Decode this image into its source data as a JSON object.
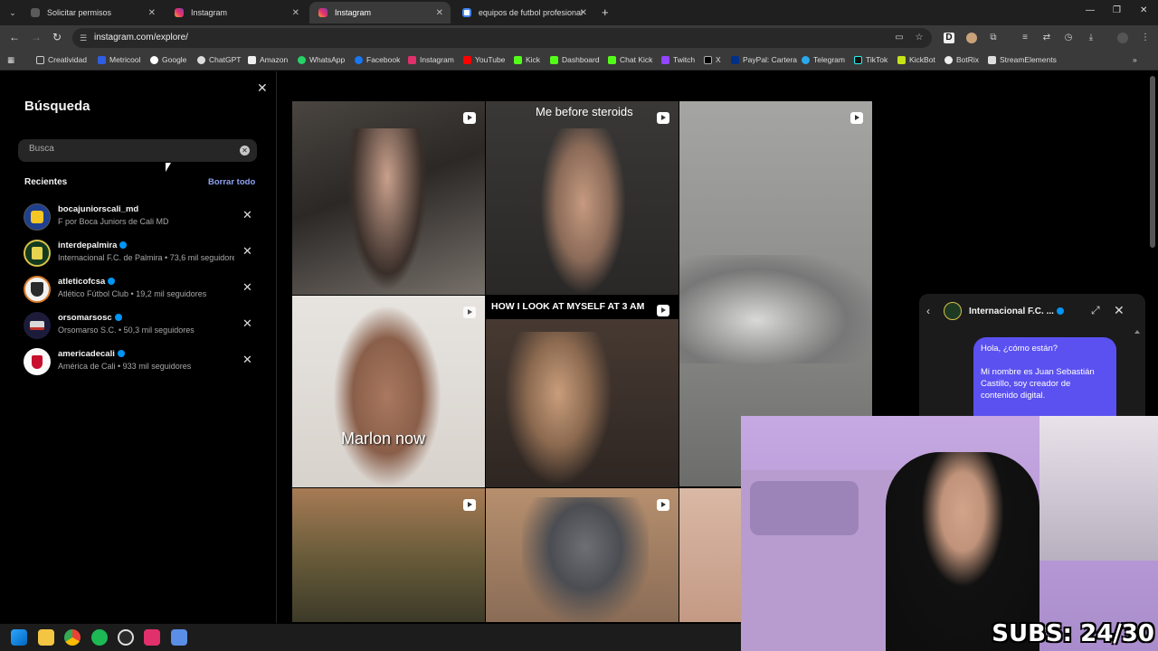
{
  "tabs": [
    {
      "label": "Solicitar permisos",
      "color": "#5a5a5a"
    },
    {
      "label": "Instagram",
      "color": "#e1306c"
    },
    {
      "label": "Instagram",
      "color": "#e1306c",
      "active": true
    },
    {
      "label": "equipos de futbol profesional d",
      "color": "#4285f4"
    }
  ],
  "url": "instagram.com/explore/",
  "bookmarks": [
    "Creatividad",
    "Metricool",
    "Google",
    "ChatGPT",
    "Amazon",
    "WhatsApp",
    "Facebook",
    "Instagram",
    "YouTube",
    "Kick",
    "Dashboard",
    "Chat Kick",
    "Twitch",
    "X",
    "PayPal: Cartera",
    "Telegram",
    "TikTok",
    "KickBot",
    "BotRix",
    "StreamElements"
  ],
  "search": {
    "title": "Búsqueda",
    "placeholder": "Busca",
    "recent_label": "Recientes",
    "clear_all": "Borrar todo",
    "recents": [
      {
        "username": "bocajuniorscali_md",
        "subtitle": "F por Boca Juniors de Cali MD",
        "verified": false
      },
      {
        "username": "interdepalmira",
        "subtitle": "Internacional F.C. de Palmira • 73,6 mil seguidores",
        "verified": true
      },
      {
        "username": "atleticofcsa",
        "subtitle": "Atlético Fútbol Club • 19,2 mil seguidores",
        "verified": true
      },
      {
        "username": "orsomarsosc",
        "subtitle": "Orsomarso S.C. • 50,3 mil seguidores",
        "verified": true
      },
      {
        "username": "americadecali",
        "subtitle": "América de Cali • 933 mil seguidores",
        "verified": true
      }
    ]
  },
  "grid": {
    "captions": {
      "tile2": "Me before steroids",
      "tile4": "Marlon now",
      "tile5": "HOW I LOOK AT MYSELF AT 3 AM"
    }
  },
  "chat": {
    "name": "Internacional F.C. ...",
    "message": "Hola, ¿cómo están?\n\nMi nombre es Juan Sebastián Castillo, soy creador de contenido digital."
  },
  "webcam": {
    "subs": "SUBS: 24/30"
  }
}
